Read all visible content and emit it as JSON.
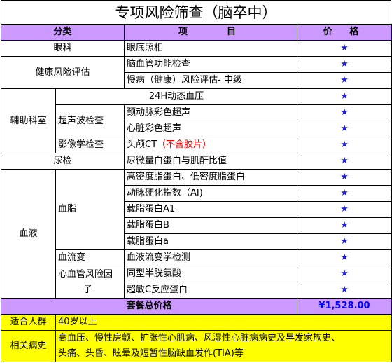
{
  "title": "专项风险筛查（脑卒中）",
  "header": {
    "category": "分类",
    "item": "项　　目",
    "price": "价 格"
  },
  "star": "★",
  "rows": {
    "eye": {
      "category": "眼科",
      "item": "眼底照相"
    },
    "health": {
      "category": "健康风险评估",
      "items": [
        "脑血管功能检查",
        "慢病（健康）风险评估- 中级"
      ]
    },
    "aux": {
      "category": "辅助科室",
      "bp_item": "24H动态血压",
      "ultrasound": {
        "sub": "超声波检查",
        "items": [
          "颈动脉彩色超声",
          "心脏彩色超声"
        ]
      },
      "imaging": {
        "sub": "影像学检查",
        "item": "头颅CT",
        "note": "（不含胶片）"
      }
    },
    "urine": {
      "category": "尿检",
      "item": "尿微量白蛋白与肌酐比值"
    },
    "blood": {
      "category": "血液",
      "lipid": {
        "sub": "血脂",
        "items": [
          "高密度脂蛋白、低密度脂蛋白",
          "动脉硬化指数（AI)",
          "载脂蛋白A1",
          "载脂蛋白B",
          "载脂蛋白a"
        ]
      },
      "rheology": {
        "sub": "血流变",
        "item": "血液流变学检测"
      },
      "cardio": {
        "sub_line1": "心血管风险因",
        "sub_line2": "子",
        "items": [
          "同型半胱氨酸",
          "超敏C反应蛋白"
        ]
      }
    }
  },
  "total": {
    "label": "套餐总价格",
    "price": "¥1,528.00"
  },
  "target": {
    "label": "适合人群",
    "value": "40岁以上"
  },
  "history": {
    "label": "相关病史",
    "value_line1": "高血压、慢性房颤、扩张性心肌病、风湿性心脏病病史及早发家族史、",
    "value_line2": "头痛、头昏、眩晕及短暂性脑缺血发作(TIA)等"
  }
}
